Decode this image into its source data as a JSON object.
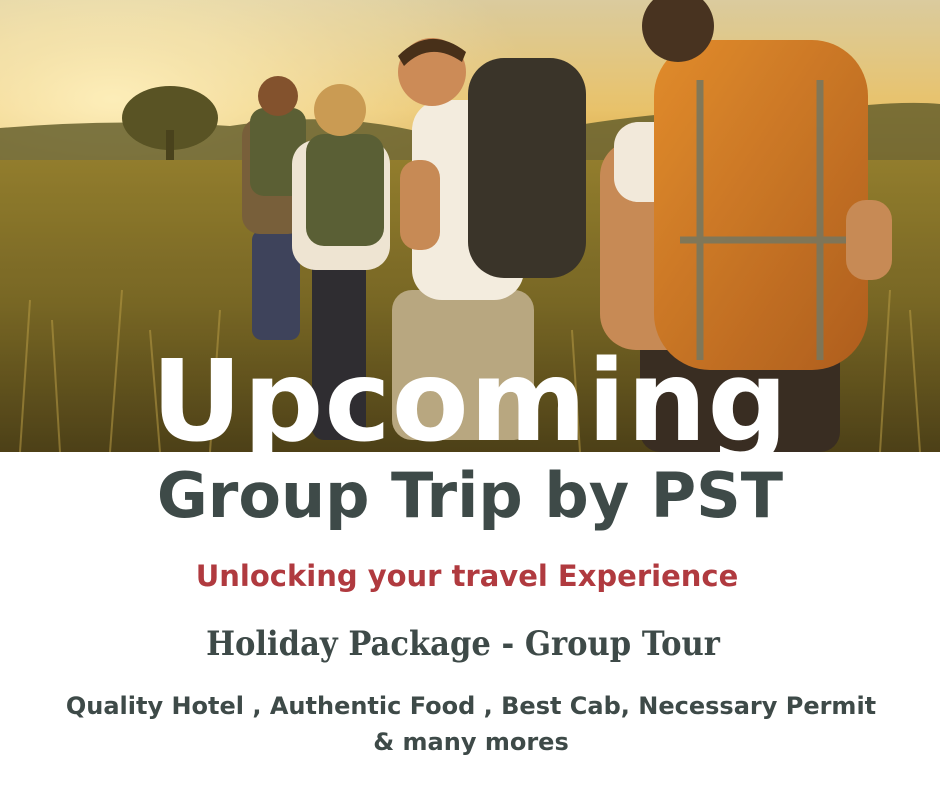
{
  "poster": {
    "headline": "Upcoming",
    "subheadline": "Group Trip by PST",
    "tagline": "Unlocking your travel Experience",
    "package": "Holiday Package - Group Tour",
    "features": "Quality Hotel , Authentic Food , Best Cab, Necessary Permit & many mores"
  },
  "colors": {
    "headline": "#ffffff",
    "subheadline": "#3e4a48",
    "tagline": "#b03a3f",
    "background": "#ffffff"
  }
}
